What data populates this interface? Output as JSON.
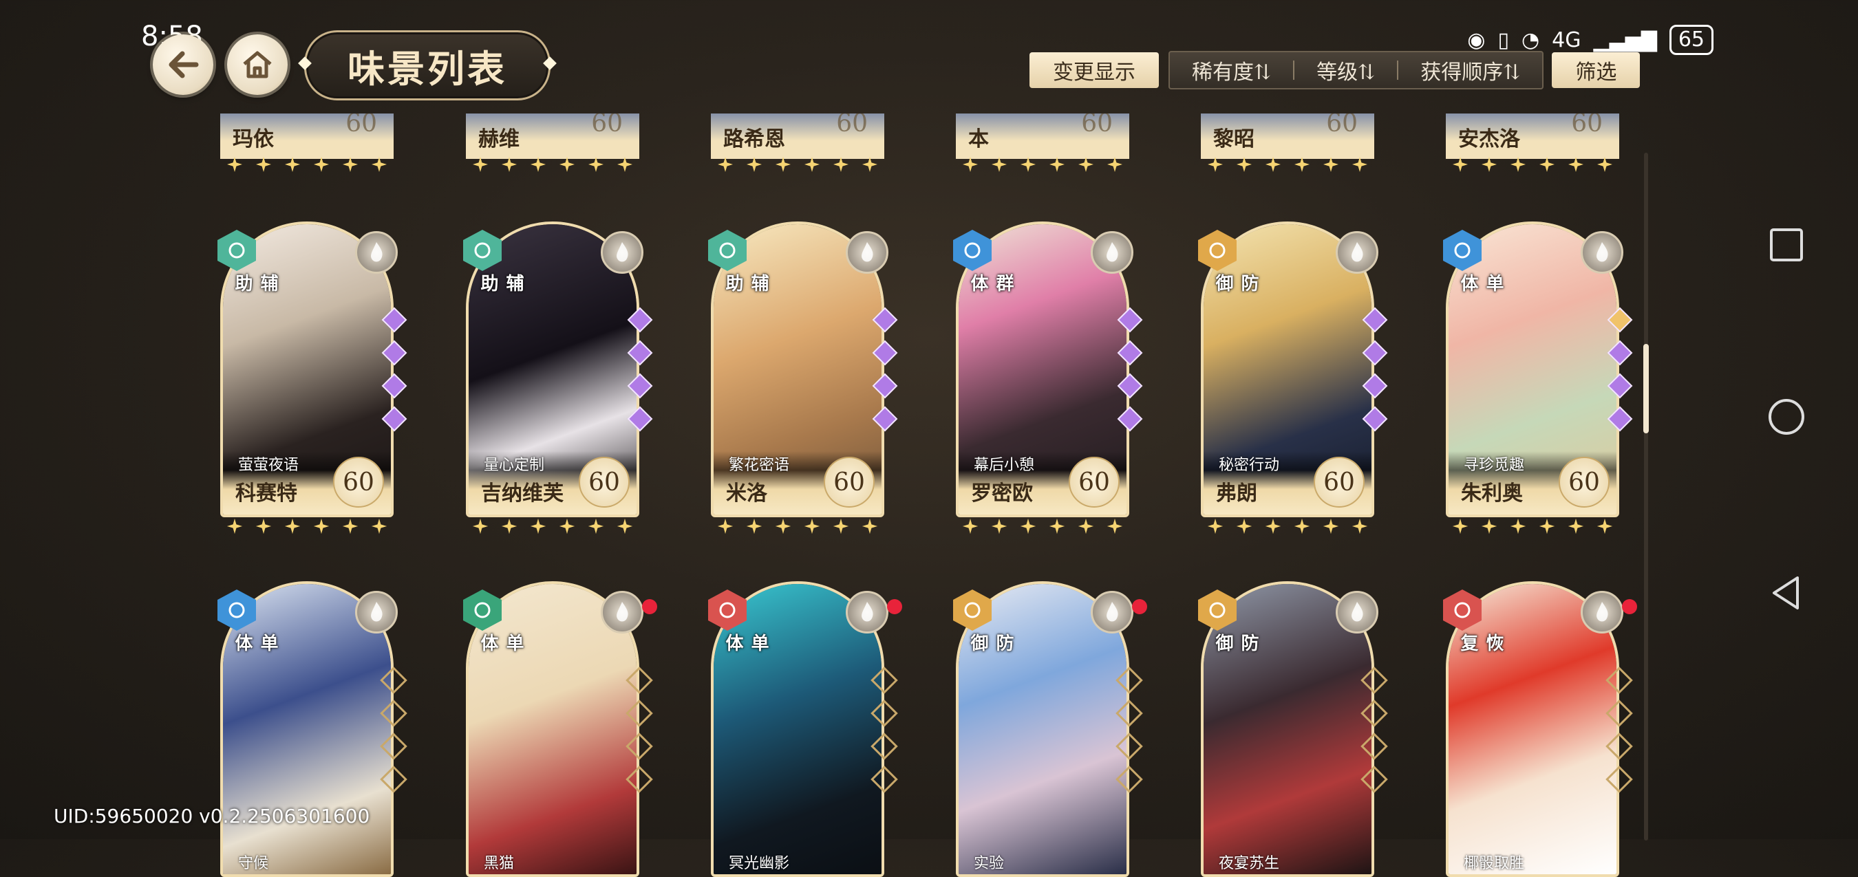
{
  "status_bar": {
    "time": "8:58",
    "network": "4G",
    "battery": "65"
  },
  "header": {
    "title": "味景列表"
  },
  "toolbar": {
    "change_display": "变更显示",
    "sort_rarity": "稀有度⇅",
    "sort_level": "等级⇅",
    "sort_order": "获得顺序⇅",
    "filter": "筛选"
  },
  "top_row": [
    {
      "name": "玛依",
      "level": "60"
    },
    {
      "name": "赫维",
      "level": "60"
    },
    {
      "name": "路希恩",
      "level": "60"
    },
    {
      "name": "本",
      "level": "60"
    },
    {
      "name": "黎昭",
      "level": "60"
    },
    {
      "name": "安杰洛",
      "level": "60"
    }
  ],
  "row1": [
    {
      "role": "辅助",
      "subtitle": "萤萤夜语",
      "name": "科赛特",
      "level": "60"
    },
    {
      "role": "辅助",
      "subtitle": "量心定制",
      "name": "吉纳维芙",
      "level": "60"
    },
    {
      "role": "辅助",
      "subtitle": "繁花密语",
      "name": "米洛",
      "level": "60"
    },
    {
      "role": "群体",
      "subtitle": "幕后小憩",
      "name": "罗密欧",
      "level": "60"
    },
    {
      "role": "防御",
      "subtitle": "秘密行动",
      "name": "弗朗",
      "level": "60"
    },
    {
      "role": "单体",
      "subtitle": "寻珍觅趣",
      "name": "朱利奥",
      "level": "60"
    }
  ],
  "row2": [
    {
      "role": "单体",
      "subtitle": "守候"
    },
    {
      "role": "单体",
      "subtitle": "黑猫"
    },
    {
      "role": "单体",
      "subtitle": "冥光幽影"
    },
    {
      "role": "防御",
      "subtitle": "实验"
    },
    {
      "role": "防御",
      "subtitle": "夜宴苏生"
    },
    {
      "role": "恢复",
      "subtitle": "椰骰取胜"
    }
  ],
  "footer": {
    "uid": "UID:59650020  v0.2.2506301600"
  },
  "colors": {
    "support": "#4fb59a",
    "group": "#3f93d9",
    "defense": "#e0a84a",
    "single_blue": "#3f93d9",
    "single_green": "#3aa57a",
    "single_red": "#d9534f",
    "recover": "#d9534f",
    "gem_purple": "#b07be6",
    "gem_gold": "#f0c36a"
  }
}
